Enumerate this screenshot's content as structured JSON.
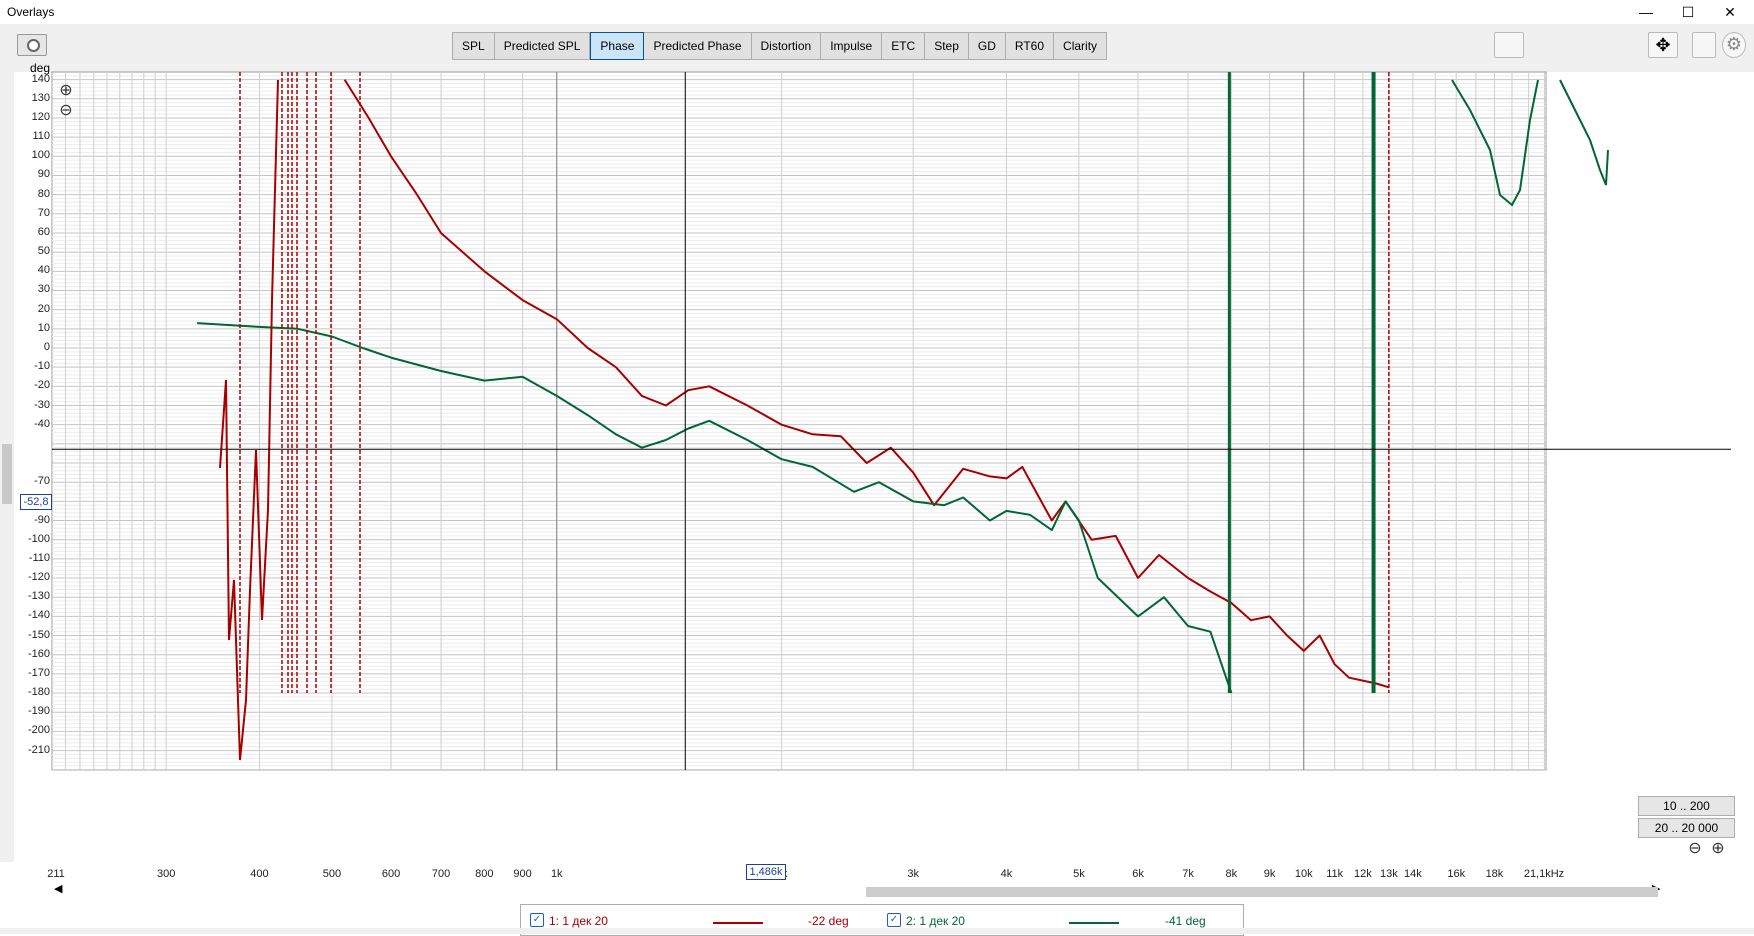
{
  "window": {
    "title": "Overlays",
    "minimize": "—",
    "maximize": "☐",
    "close": "✕"
  },
  "tabs": [
    "SPL",
    "Predicted SPL",
    "Phase",
    "Predicted Phase",
    "Distortion",
    "Impulse",
    "ETC",
    "Step",
    "GD",
    "RT60",
    "Clarity"
  ],
  "active_tab": "Phase",
  "cursor": {
    "y_readout": "-52,8",
    "x_readout": "1,486k",
    "y_value": -52.8,
    "x_value": 1486
  },
  "range_buttons": [
    "10 .. 200",
    "20 .. 20 000"
  ],
  "legend": [
    {
      "check": "✓",
      "name": "1: 1 дек 20",
      "value": "-22 deg",
      "color": "#a80000"
    },
    {
      "check": "✓",
      "name": "2: 1 дек 20",
      "value": "-41 deg",
      "color": "#006633"
    }
  ],
  "chart_data": {
    "type": "line",
    "ylabel": "deg",
    "xlabel": "",
    "xscale": "log",
    "xlim": [
      211,
      21100
    ],
    "ylim": [
      -220,
      145
    ],
    "yticks": [
      140,
      130,
      120,
      110,
      100,
      90,
      80,
      70,
      60,
      50,
      40,
      30,
      20,
      10,
      0,
      -10,
      -20,
      -30,
      -40,
      -70,
      -80,
      -90,
      -100,
      -110,
      -120,
      -130,
      -140,
      -150,
      -160,
      -170,
      -180,
      -190,
      -200,
      -210
    ],
    "xtick_labels": [
      {
        "v": 211,
        "t": "211"
      },
      {
        "v": 300,
        "t": "300"
      },
      {
        "v": 400,
        "t": "400"
      },
      {
        "v": 500,
        "t": "500"
      },
      {
        "v": 600,
        "t": "600"
      },
      {
        "v": 700,
        "t": "700"
      },
      {
        "v": 800,
        "t": "800"
      },
      {
        "v": 900,
        "t": "900"
      },
      {
        "v": 1000,
        "t": "1k"
      },
      {
        "v": 2000,
        "t": "2k"
      },
      {
        "v": 3000,
        "t": "3k"
      },
      {
        "v": 4000,
        "t": "4k"
      },
      {
        "v": 5000,
        "t": "5k"
      },
      {
        "v": 6000,
        "t": "6k"
      },
      {
        "v": 7000,
        "t": "7k"
      },
      {
        "v": 8000,
        "t": "8k"
      },
      {
        "v": 9000,
        "t": "9k"
      },
      {
        "v": 10000,
        "t": "10k"
      },
      {
        "v": 11000,
        "t": "11k"
      },
      {
        "v": 12000,
        "t": "12k"
      },
      {
        "v": 13000,
        "t": "13k"
      },
      {
        "v": 14000,
        "t": "14k"
      },
      {
        "v": 16000,
        "t": "16k"
      },
      {
        "v": 18000,
        "t": "18k"
      },
      {
        "v": 21100,
        "t": "21,1kHz"
      }
    ],
    "series": [
      {
        "name": "1: 1 дек 20",
        "color": "#a80000",
        "points": [
          [
            520,
            140
          ],
          [
            560,
            120
          ],
          [
            600,
            100
          ],
          [
            650,
            80
          ],
          [
            700,
            60
          ],
          [
            800,
            40
          ],
          [
            900,
            25
          ],
          [
            1000,
            15
          ],
          [
            1100,
            0
          ],
          [
            1200,
            -10
          ],
          [
            1300,
            -25
          ],
          [
            1400,
            -30
          ],
          [
            1500,
            -22
          ],
          [
            1600,
            -20
          ],
          [
            1800,
            -30
          ],
          [
            2000,
            -40
          ],
          [
            2200,
            -45
          ],
          [
            2400,
            -46
          ],
          [
            2600,
            -60
          ],
          [
            2800,
            -52
          ],
          [
            3000,
            -65
          ],
          [
            3200,
            -82
          ],
          [
            3500,
            -63
          ],
          [
            3800,
            -67
          ],
          [
            4000,
            -68
          ],
          [
            4200,
            -62
          ],
          [
            4600,
            -90
          ],
          [
            4800,
            -80
          ],
          [
            5200,
            -100
          ],
          [
            5600,
            -98
          ],
          [
            6000,
            -120
          ],
          [
            6400,
            -108
          ],
          [
            7000,
            -120
          ],
          [
            7500,
            -127
          ],
          [
            8000,
            -133
          ],
          [
            8500,
            -142
          ],
          [
            9000,
            -140
          ],
          [
            9500,
            -150
          ],
          [
            10000,
            -158
          ],
          [
            10500,
            -150
          ],
          [
            11000,
            -165
          ],
          [
            11500,
            -172
          ],
          [
            12500,
            -175
          ],
          [
            13000,
            -177
          ]
        ]
      },
      {
        "name": "2: 1 дек 20",
        "color": "#006633",
        "points": [
          [
            330,
            13
          ],
          [
            400,
            11
          ],
          [
            450,
            10
          ],
          [
            500,
            6
          ],
          [
            550,
            0
          ],
          [
            600,
            -5
          ],
          [
            700,
            -12
          ],
          [
            800,
            -17
          ],
          [
            900,
            -15
          ],
          [
            1000,
            -25
          ],
          [
            1100,
            -35
          ],
          [
            1200,
            -45
          ],
          [
            1300,
            -52
          ],
          [
            1400,
            -48
          ],
          [
            1500,
            -42
          ],
          [
            1600,
            -38
          ],
          [
            1800,
            -48
          ],
          [
            2000,
            -58
          ],
          [
            2200,
            -62
          ],
          [
            2500,
            -75
          ],
          [
            2700,
            -70
          ],
          [
            3000,
            -80
          ],
          [
            3300,
            -82
          ],
          [
            3500,
            -78
          ],
          [
            3800,
            -90
          ],
          [
            4000,
            -85
          ],
          [
            4300,
            -87
          ],
          [
            4600,
            -95
          ],
          [
            4800,
            -80
          ],
          [
            5000,
            -90
          ],
          [
            5300,
            -120
          ],
          [
            6000,
            -140
          ],
          [
            6500,
            -130
          ],
          [
            7000,
            -145
          ],
          [
            7500,
            -148
          ],
          [
            8000,
            -180
          ]
        ]
      }
    ]
  }
}
